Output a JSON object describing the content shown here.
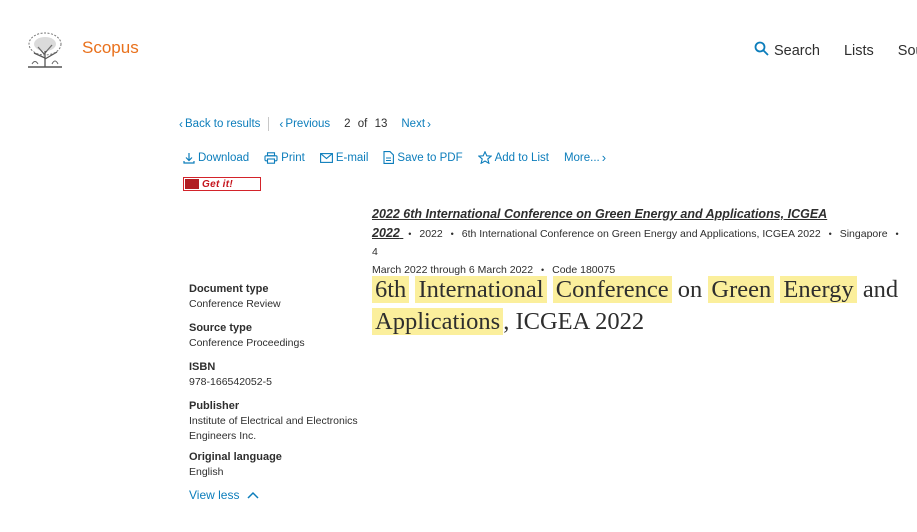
{
  "header": {
    "brand": "Scopus",
    "nav": [
      "Search",
      "Lists",
      "Sou"
    ]
  },
  "result_nav": {
    "back": "Back to results",
    "previous": "Previous",
    "current": "2",
    "of_label": "of",
    "total": "13",
    "next": "Next"
  },
  "actions": {
    "download": "Download",
    "print": "Print",
    "email": "E-mail",
    "save_pdf": "Save to PDF",
    "add_list": "Add to List",
    "more": "More..."
  },
  "getit": {
    "label": "Get it!"
  },
  "source": {
    "title_line1": "2022 6th International Conference on Green Energy and Applications, ICGEA",
    "title_line2": "2022",
    "year": "2022",
    "conf": "6th International Conference on Green Energy and Applications, ICGEA 2022",
    "location": "Singapore",
    "date_part1": "4",
    "date_part2": "March 2022 through 6 March 2022",
    "code": "Code 180075"
  },
  "meta": [
    {
      "label": "Document type",
      "value": "Conference Review"
    },
    {
      "label": "Source type",
      "value": "Conference Proceedings"
    },
    {
      "label": "ISBN",
      "value": "978-166542052-5"
    },
    {
      "label": "Publisher",
      "value": "Institute of Electrical and Electronics Engineers Inc."
    },
    {
      "label": "Original language",
      "value": "English"
    }
  ],
  "view_less": "View less",
  "doc_title": {
    "w1": "6th",
    "w2": "International",
    "w3": "Conference",
    "w4": "on",
    "w5": "Green",
    "w6": "Energy",
    "w7": "and",
    "w8": "Applications",
    "w9": ", ICGEA 2022"
  },
  "colors": {
    "accent": "#0c7dbb",
    "brand": "#e9711c",
    "highlight": "#fbef9c"
  },
  "icons": [
    "elsevier-logo",
    "search-icon",
    "download-icon",
    "print-icon",
    "email-icon",
    "pdf-icon",
    "star-icon",
    "chevron-right-icon",
    "chevron-left-icon",
    "chevron-up-icon"
  ]
}
